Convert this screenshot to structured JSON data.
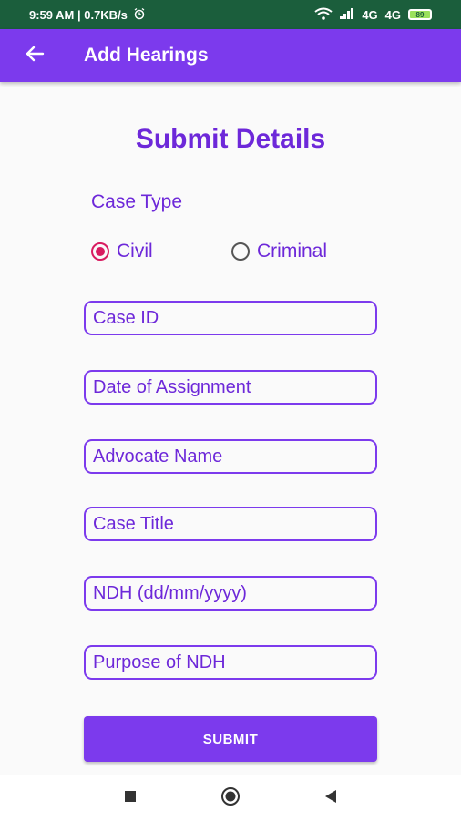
{
  "status_bar": {
    "time_speed": "9:59 AM | 0.7KB/s",
    "network_1": "4G",
    "network_2": "4G",
    "battery": "89"
  },
  "app_bar": {
    "title": "Add Hearings"
  },
  "form": {
    "title": "Submit Details",
    "case_type_label": "Case Type",
    "options": [
      {
        "label": "Civil",
        "checked": true
      },
      {
        "label": "Criminal",
        "checked": false
      }
    ],
    "fields": [
      {
        "placeholder": "Case ID"
      },
      {
        "placeholder": "Date of Assignment"
      },
      {
        "placeholder": "Advocate Name"
      },
      {
        "placeholder": "Case Title"
      },
      {
        "placeholder": "NDH (dd/mm/yyyy)"
      },
      {
        "placeholder": "Purpose of NDH"
      }
    ],
    "submit_label": "SUBMIT"
  },
  "colors": {
    "status_bar": "#1b5e3c",
    "primary": "#7c3aed",
    "text_primary": "#6d28d9",
    "radio_checked": "#d81b60"
  },
  "icons": {
    "back": "arrow-left-icon",
    "nav_recent": "square-icon",
    "nav_home": "circle-icon",
    "nav_back": "triangle-left-icon"
  }
}
